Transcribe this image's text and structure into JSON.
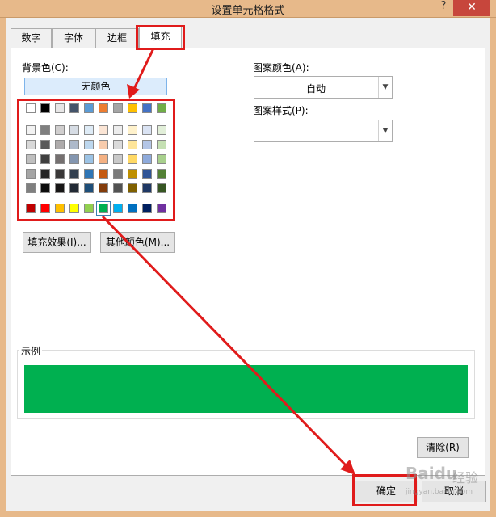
{
  "window": {
    "title": "设置单元格格式",
    "help": "?",
    "close": "✕"
  },
  "tabs": [
    "数字",
    "字体",
    "边框",
    "填充"
  ],
  "fill": {
    "bg_label": "背景色(C):",
    "no_color": "无颜色",
    "theme_rows": [
      [
        "#ffffff",
        "#000000",
        "#e7e6e6",
        "#44546a",
        "#5b9bd5",
        "#ed7d31",
        "#a5a5a5",
        "#ffc000",
        "#4472c4",
        "#70ad47"
      ],
      [
        "#f2f2f2",
        "#7f7f7f",
        "#d0cece",
        "#d6dce4",
        "#deebf6",
        "#fbe5d5",
        "#ededed",
        "#fff2cc",
        "#dae3f3",
        "#e2efd9"
      ],
      [
        "#d8d8d8",
        "#595959",
        "#aeabab",
        "#adb9ca",
        "#bdd7ee",
        "#f7cbac",
        "#dbdbdb",
        "#fee599",
        "#b4c6e7",
        "#c5e0b3"
      ],
      [
        "#bfbfbf",
        "#3f3f3f",
        "#757070",
        "#8496b0",
        "#9cc3e5",
        "#f4b183",
        "#c9c9c9",
        "#ffd965",
        "#8eaadb",
        "#a8d08d"
      ],
      [
        "#a5a5a5",
        "#262626",
        "#3a3838",
        "#323f4f",
        "#2e75b5",
        "#c55a11",
        "#7b7b7b",
        "#bf9000",
        "#2f5496",
        "#538135"
      ],
      [
        "#7f7f7f",
        "#0c0c0c",
        "#171616",
        "#222a35",
        "#1e4e79",
        "#833c0b",
        "#525252",
        "#7f6000",
        "#1f3864",
        "#375623"
      ]
    ],
    "standard_row": [
      "#c00000",
      "#ff0000",
      "#ffc000",
      "#ffff00",
      "#92d050",
      "#00b050",
      "#00b0f0",
      "#0070c0",
      "#002060",
      "#7030a0"
    ],
    "selected_color": "#00b050",
    "fill_effects": "填充效果(I)...",
    "more_colors": "其他颜色(M)...",
    "pattern_color_label": "图案颜色(A):",
    "pattern_color_value": "自动",
    "pattern_style_label": "图案样式(P):",
    "pattern_style_value": "",
    "sample_label": "示例",
    "sample_color": "#00b050",
    "clear": "清除(R)"
  },
  "footer": {
    "ok": "确定",
    "cancel": "取消"
  },
  "annotation": {
    "highlight_color": "#e01b1b"
  },
  "watermark": {
    "text1": "Baidu",
    "text2": "经验",
    "text3": "jingyan.baidu.com"
  }
}
